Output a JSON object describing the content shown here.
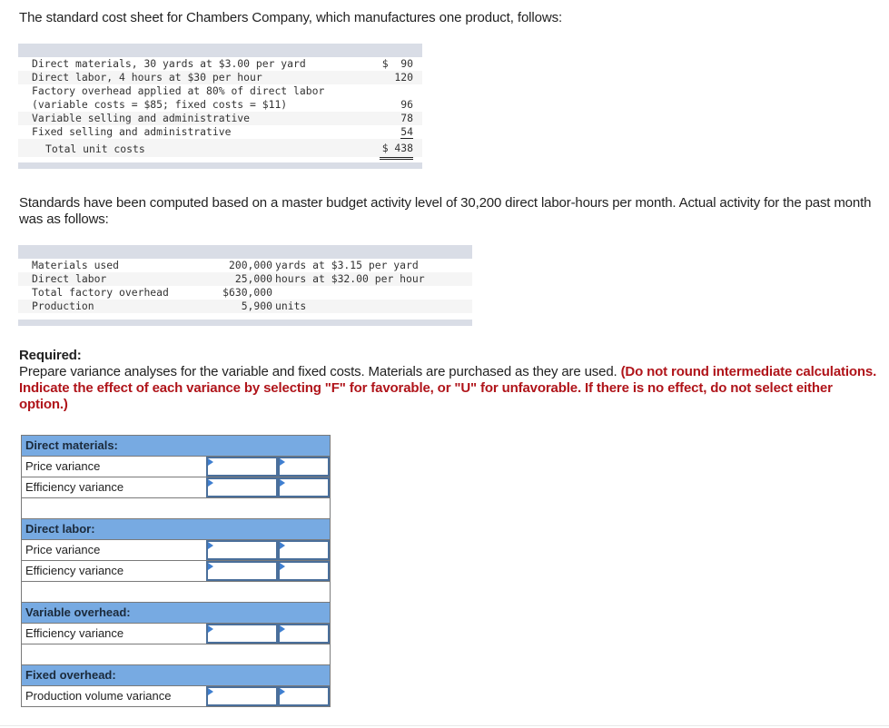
{
  "intro": "The standard cost sheet for Chambers Company, which manufactures one product, follows:",
  "cost_sheet": {
    "rows": [
      {
        "label": "Direct materials, 30 yards at $3.00 per yard",
        "amount": "$  90"
      },
      {
        "label": "Direct labor, 4 hours at $30 per hour",
        "amount": "120"
      },
      {
        "label": "Factory overhead applied at 80% of direct labor",
        "amount": ""
      },
      {
        "label": "(variable costs = $85; fixed costs = $11)",
        "amount": "96"
      },
      {
        "label": "Variable selling and administrative",
        "amount": "78"
      },
      {
        "label": "Fixed selling and administrative",
        "amount": "54"
      }
    ],
    "total": {
      "label": "Total unit costs",
      "amount": "$ 438"
    }
  },
  "paragraph2": "Standards have been computed based on a master budget activity level of 30,200 direct labor-hours per month. Actual activity for the past month was as follows:",
  "actual": {
    "rows": [
      {
        "label": "Materials used",
        "value": "200,000",
        "desc": "yards at $3.15 per yard"
      },
      {
        "label": "Direct labor",
        "value": "25,000",
        "desc": "hours at $32.00 per hour"
      },
      {
        "label": "Total factory overhead",
        "value": "$630,000",
        "desc": ""
      },
      {
        "label": "Production",
        "value": "5,900",
        "desc": "units"
      }
    ]
  },
  "required": {
    "heading": "Required:",
    "text": "Prepare variance analyses for the variable and fixed costs. Materials are purchased as they are used. ",
    "instruction": "(Do not round intermediate calculations. Indicate the effect of each variance by selecting \"F\" for favorable, or \"U\" for unfavorable. If there is no effect, do not select either option.)"
  },
  "answer_table": {
    "sections": [
      {
        "title": "Direct materials:",
        "rows": [
          {
            "label": "Price variance",
            "amount": "",
            "effect": ""
          },
          {
            "label": "Efficiency variance",
            "amount": "",
            "effect": ""
          }
        ]
      },
      {
        "title": "Direct labor:",
        "rows": [
          {
            "label": "Price variance",
            "amount": "",
            "effect": ""
          },
          {
            "label": "Efficiency variance",
            "amount": "",
            "effect": ""
          }
        ]
      },
      {
        "title": "Variable overhead:",
        "rows": [
          {
            "label": "Efficiency variance",
            "amount": "",
            "effect": ""
          }
        ]
      },
      {
        "title": "Fixed overhead:",
        "rows": [
          {
            "label": "Production volume variance",
            "amount": "",
            "effect": ""
          }
        ]
      }
    ]
  },
  "colors": {
    "section_header": "#77aae2",
    "instruction_red": "#b0141a",
    "input_border": "#4a6f9b",
    "band": "#d9dde6"
  }
}
